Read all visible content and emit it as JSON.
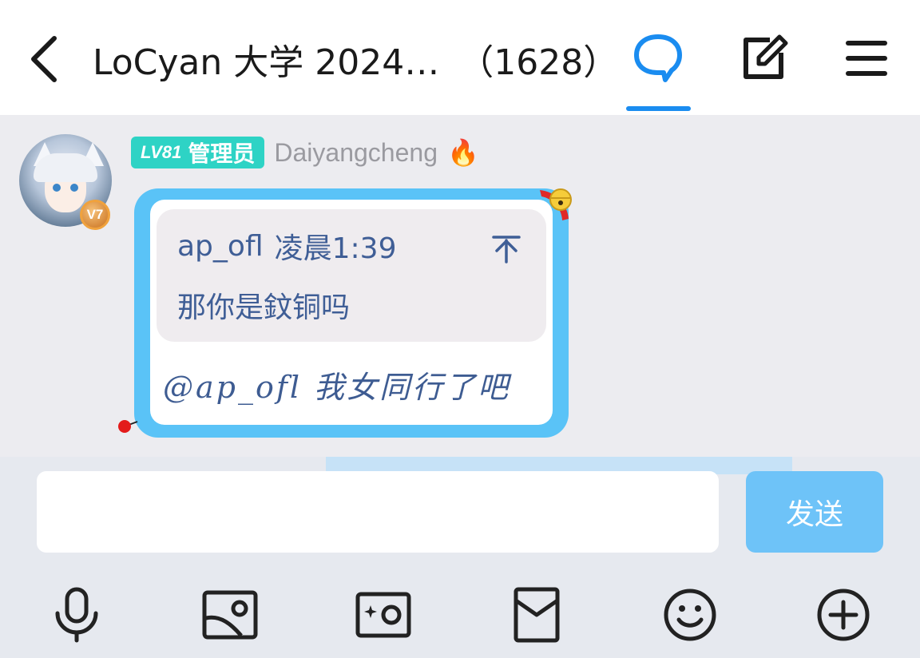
{
  "header": {
    "group_name": "LoCyan 大学 2024…",
    "member_count": "（1628）",
    "accent_color": "#1a8cf0",
    "icons": [
      "back-arrow-icon",
      "chat-bubble-icon",
      "edit-icon",
      "menu-icon"
    ]
  },
  "message": {
    "level": "LV81",
    "role": "管理员",
    "nickname": "Daiyangcheng",
    "nickname_emoji": "🔥",
    "vip_level": "V7",
    "quote": {
      "author": "ap_ofl",
      "time": "凌晨1:39",
      "text": "那你是鈫铜吗"
    },
    "reply": "@ap_ofl 我女同行了吧",
    "bubble_color": "#5ac3f7"
  },
  "composer": {
    "input_value": "",
    "send_label": "发送",
    "send_color": "#6ec3f8",
    "toolbar_icons": [
      "microphone-icon",
      "image-icon",
      "camera-icon",
      "red-envelope-icon",
      "emoji-icon",
      "plus-icon"
    ]
  }
}
